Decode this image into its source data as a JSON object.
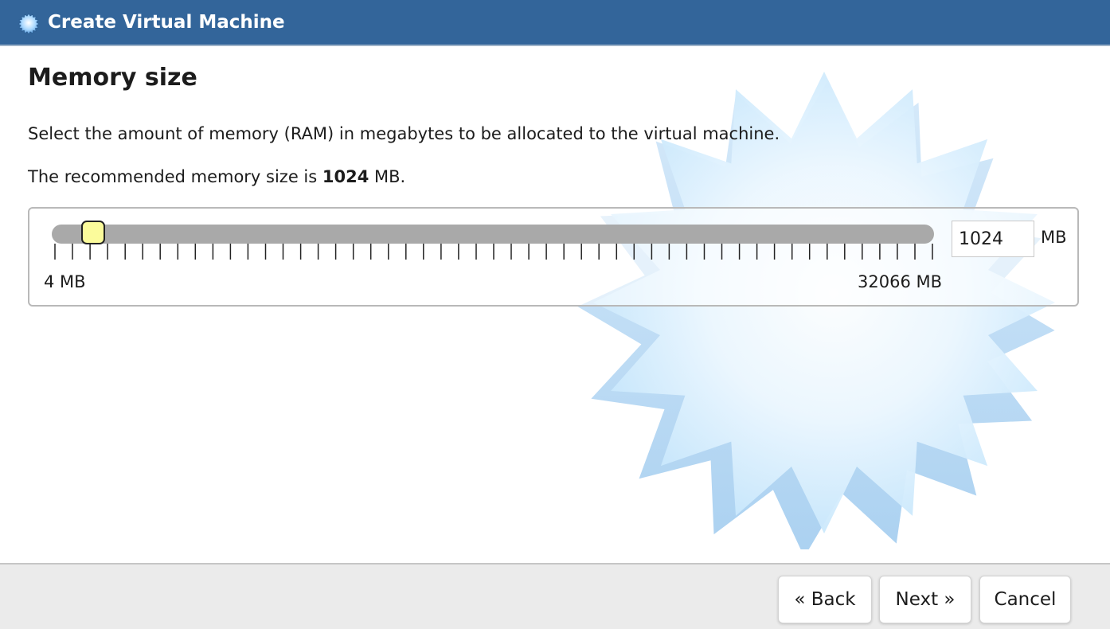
{
  "window": {
    "title": "Create Virtual Machine"
  },
  "page": {
    "heading": "Memory size",
    "description": "Select the amount of memory (RAM) in megabytes to be allocated to the virtual machine.",
    "recommend_prefix": "The recommended memory size is ",
    "recommend_value": "1024",
    "recommend_suffix": " MB."
  },
  "memory": {
    "value": "1024",
    "unit": "MB",
    "min_label": "4 MB",
    "max_label": "32066 MB",
    "min": 4,
    "max": 32066,
    "slider_value": 1024,
    "tick_count": 51,
    "handle_color": "#fbfb9b",
    "track_color": "#a9a9a9"
  },
  "footer": {
    "back_label": "« Back",
    "next_label": "Next »",
    "cancel_label": "Cancel"
  },
  "icons": {
    "title_icon": "virtualbox-starburst-icon",
    "background_art": "starburst-decoration"
  },
  "colors": {
    "titlebar": "#33659a",
    "footer": "#ebebeb"
  }
}
